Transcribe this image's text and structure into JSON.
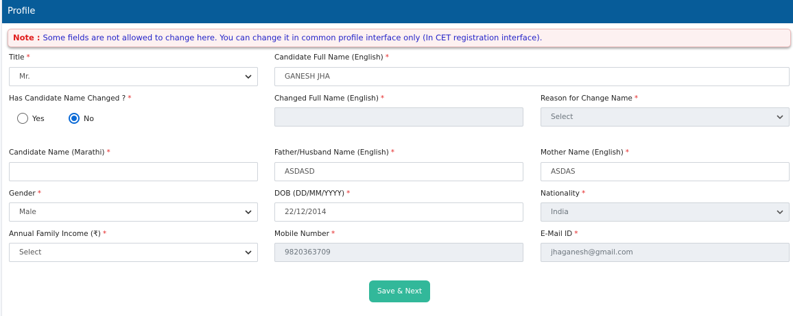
{
  "header": {
    "title": "Profile"
  },
  "note": {
    "label": "Note :",
    "text": "Some fields are not allowed to change here. You can change it in common profile interface only (In CET registration interface)."
  },
  "required_mark": "*",
  "fields": {
    "title": {
      "label": "Title",
      "value": "Mr."
    },
    "full_name": {
      "label": "Candidate Full Name (English)",
      "value": "GANESH JHA"
    },
    "name_changed": {
      "label": "Has Candidate Name Changed ?",
      "options": [
        "Yes",
        "No"
      ],
      "selected": "No"
    },
    "changed_name": {
      "label": "Changed Full Name (English)",
      "value": ""
    },
    "reason_change": {
      "label": "Reason for Change Name",
      "value": "Select"
    },
    "name_marathi": {
      "label": "Candidate Name (Marathi)",
      "value": ""
    },
    "father_name": {
      "label": "Father/Husband Name (English)",
      "value": "ASDASD"
    },
    "mother_name": {
      "label": "Mother Name (English)",
      "value": "ASDAS"
    },
    "gender": {
      "label": "Gender",
      "value": "Male"
    },
    "dob": {
      "label": "DOB (DD/MM/YYYY)",
      "value": "22/12/2014"
    },
    "nationality": {
      "label": "Nationality",
      "value": "India"
    },
    "income": {
      "label": "Annual Family Income (₹)",
      "value": "Select"
    },
    "mobile": {
      "label": "Mobile Number",
      "value": "9820363709"
    },
    "email": {
      "label": "E-Mail ID",
      "value": "jhaganesh@gmail.com"
    }
  },
  "actions": {
    "save_next": "Save & Next"
  },
  "colors": {
    "header_bg": "#075c99",
    "note_label": "#e01b1b",
    "note_text": "#2222c8",
    "required": "#e52727",
    "button_bg": "#32b89a",
    "radio_checked": "#0b6ad6"
  }
}
